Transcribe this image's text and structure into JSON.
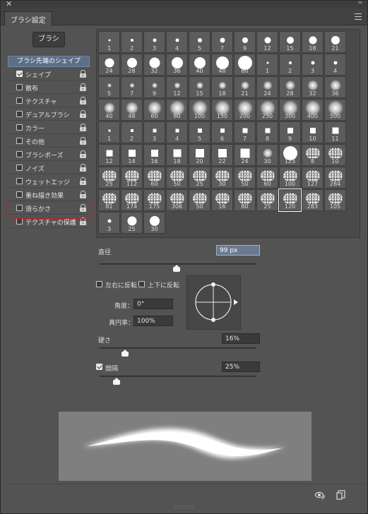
{
  "window": {
    "close_label": "✕",
    "collapse_label": "‹‹",
    "tab_title": "ブラシ設定"
  },
  "brush_button": {
    "label": "ブラシ"
  },
  "sidebar": {
    "header": "ブラシ先端のシェイプ",
    "items": [
      {
        "label": "シェイプ",
        "checked": true
      },
      {
        "label": "散布",
        "checked": false
      },
      {
        "label": "テクスチャ",
        "checked": false
      },
      {
        "label": "デュアルブラシ",
        "checked": false
      },
      {
        "label": "カラー",
        "checked": false
      },
      {
        "label": "その他",
        "checked": false
      },
      {
        "label": "ブラシポーズ",
        "checked": false
      },
      {
        "label": "ノイズ",
        "checked": false
      },
      {
        "label": "ウェットエッジ",
        "checked": false
      },
      {
        "label": "重ね描き効果",
        "checked": false
      },
      {
        "label": "滑らかさ",
        "checked": false
      },
      {
        "label": "テクスチャの保護",
        "checked": false
      }
    ]
  },
  "brush_grid": {
    "sizes": [
      "1",
      "2",
      "3",
      "4",
      "5",
      "7",
      "9",
      "12",
      "15",
      "18",
      "21",
      "24",
      "28",
      "32",
      "36",
      "40",
      "48",
      "60",
      "1",
      "2",
      "3",
      "4",
      "5",
      "7",
      "9",
      "12",
      "15",
      "18",
      "21",
      "24",
      "28",
      "32",
      "36",
      "40",
      "48",
      "60",
      "80",
      "100",
      "150",
      "200",
      "250",
      "300",
      "400",
      "500",
      "1",
      "2",
      "3",
      "4",
      "5",
      "6",
      "7",
      "8",
      "9",
      "10",
      "11",
      "12",
      "14",
      "16",
      "18",
      "20",
      "22",
      "24",
      "30",
      "123",
      "8",
      "10",
      "25",
      "112",
      "60",
      "50",
      "25",
      "30",
      "50",
      "60",
      "100",
      "127",
      "284",
      "81",
      "174",
      "175",
      "306",
      "50",
      "16",
      "80",
      "25",
      "120",
      "283",
      "105",
      "3",
      "25",
      "30"
    ],
    "selected_index": 85
  },
  "diameter": {
    "label": "直径",
    "value": "99 px",
    "slider_fraction": 0.49
  },
  "flip": {
    "x_label": "左右に反転",
    "y_label": "上下に反転"
  },
  "angle": {
    "label": "角度：",
    "value": "0°"
  },
  "roundness": {
    "label": "真円率：",
    "value": "100%"
  },
  "hardness": {
    "label": "硬さ",
    "value": "16%",
    "slider_fraction": 0.16
  },
  "spacing": {
    "label": "間隔",
    "value": "25%",
    "checked": true,
    "slider_fraction": 0.11
  },
  "footer": {
    "icons": [
      "eye-brush-icon",
      "new-preset-icon"
    ]
  }
}
